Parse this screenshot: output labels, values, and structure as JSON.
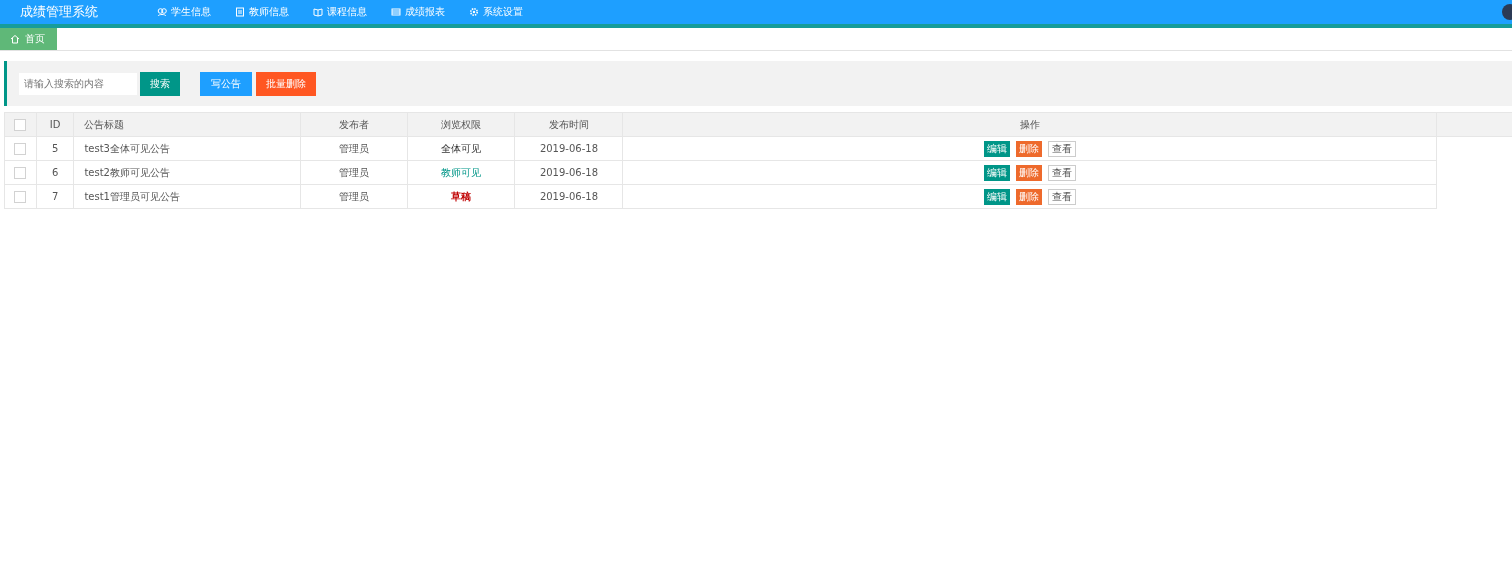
{
  "header": {
    "title": "成绩管理系统",
    "nav": [
      {
        "label": "学生信息"
      },
      {
        "label": "教师信息"
      },
      {
        "label": "课程信息"
      },
      {
        "label": "成绩报表"
      },
      {
        "label": "系统设置"
      }
    ]
  },
  "tabs": [
    {
      "label": "首页",
      "selected": true
    }
  ],
  "toolbar": {
    "search": {
      "placeholder": "请输入搜索的内容"
    },
    "buttons": [
      {
        "label": "搜索",
        "kind": "primary"
      },
      {
        "label": "写公告",
        "kind": "normal"
      },
      {
        "label": "批量删除",
        "kind": "danger"
      }
    ]
  },
  "table": {
    "columns": [
      "ID",
      "公告标题",
      "发布者",
      "浏览权限",
      "发布时间",
      "操作"
    ],
    "select_all": {
      "checked": false
    },
    "rows": [
      {
        "checked": false,
        "id": "5",
        "title": "test3全体可见公告",
        "publisher": "管理员",
        "permission": {
          "text": "全体可见",
          "kind": "public"
        },
        "time": "2019-06-18",
        "actions": [
          "编辑",
          "删除",
          "查看"
        ]
      },
      {
        "checked": false,
        "id": "6",
        "title": "test2教师可见公告",
        "publisher": "管理员",
        "permission": {
          "text": "教师可见",
          "kind": "teacher"
        },
        "time": "2019-06-18",
        "actions": [
          "编辑",
          "删除",
          "查看"
        ]
      },
      {
        "checked": false,
        "id": "7",
        "title": "test1管理员可见公告",
        "publisher": "管理员",
        "permission": {
          "text": "草稿",
          "kind": "draft"
        },
        "time": "2019-06-18",
        "actions": [
          "编辑",
          "删除",
          "查看"
        ]
      }
    ]
  }
}
